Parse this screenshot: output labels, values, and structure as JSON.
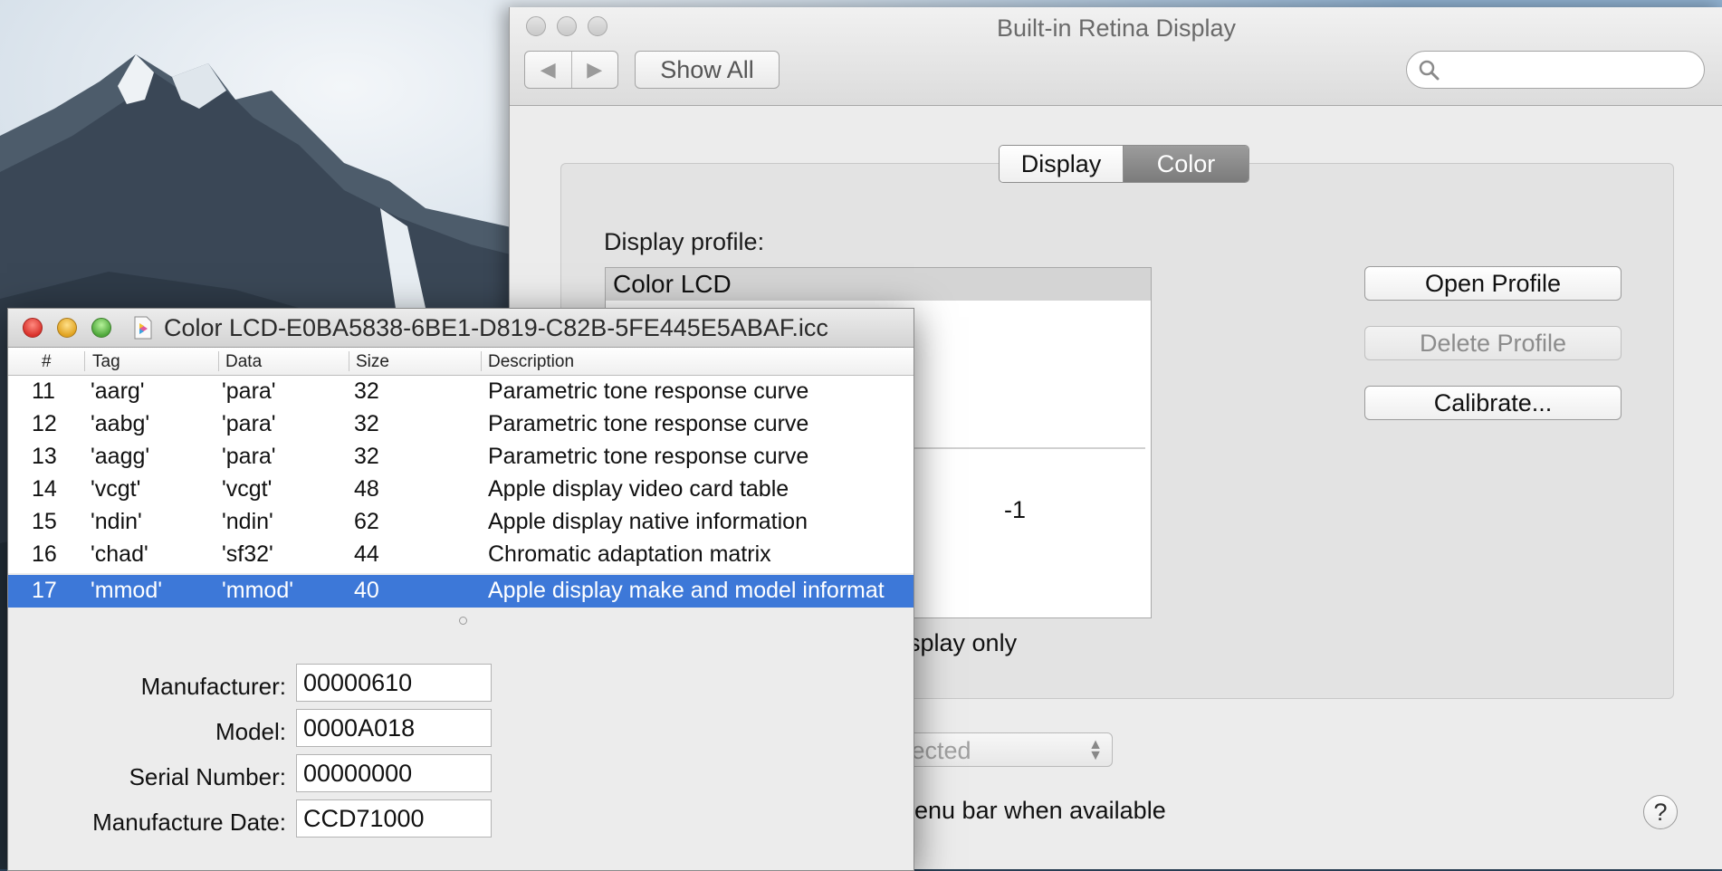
{
  "prefs_window": {
    "title": "Built-in Retina Display",
    "nav_back": "◀",
    "nav_forward": "▶",
    "show_all": "Show All",
    "search_placeholder": "",
    "tabs": [
      {
        "label": "Display",
        "selected": false
      },
      {
        "label": "Color",
        "selected": true
      }
    ],
    "display_profile_label": "Display profile:",
    "profiles": {
      "selected": "Color LCD"
    },
    "profile_fragment": "-1",
    "buttons": {
      "open_profile": "Open Profile",
      "delete_profile": "Delete Profile",
      "calibrate": "Calibrate..."
    },
    "checkbox_fragment": "splay only",
    "popup_fragment": "etected",
    "menubar_fragment": "e menu bar when available",
    "help": "?"
  },
  "icc_window": {
    "title": "Color LCD-E0BA5838-6BE1-D819-C82B-5FE445E5ABAF.icc",
    "columns": [
      "#",
      "Tag",
      "Data",
      "Size",
      "Description"
    ],
    "rows": [
      {
        "num": "11",
        "tag": "'aarg'",
        "data": "'para'",
        "size": "32",
        "description": "Parametric tone response curve"
      },
      {
        "num": "12",
        "tag": "'aabg'",
        "data": "'para'",
        "size": "32",
        "description": "Parametric tone response curve"
      },
      {
        "num": "13",
        "tag": "'aagg'",
        "data": "'para'",
        "size": "32",
        "description": "Parametric tone response curve"
      },
      {
        "num": "14",
        "tag": "'vcgt'",
        "data": "'vcgt'",
        "size": "48",
        "description": "Apple display video card table"
      },
      {
        "num": "15",
        "tag": "'ndin'",
        "data": "'ndin'",
        "size": "62",
        "description": "Apple display native information"
      },
      {
        "num": "16",
        "tag": "'chad'",
        "data": "'sf32'",
        "size": "44",
        "description": "Chromatic adaptation matrix"
      },
      {
        "num": "17",
        "tag": "'mmod'",
        "data": "'mmod'",
        "size": "40",
        "description": "Apple display make and model informat"
      }
    ],
    "selected_row": 6,
    "details": {
      "manufacturer_label": "Manufacturer:",
      "manufacturer": "00000610",
      "model_label": "Model:",
      "model": "0000A018",
      "serial_label": "Serial Number:",
      "serial": "00000000",
      "date_label": "Manufacture Date:",
      "date": "CCD71000"
    }
  },
  "colors": {
    "selection": "#3d78d8",
    "window_bg": "#ececec"
  }
}
